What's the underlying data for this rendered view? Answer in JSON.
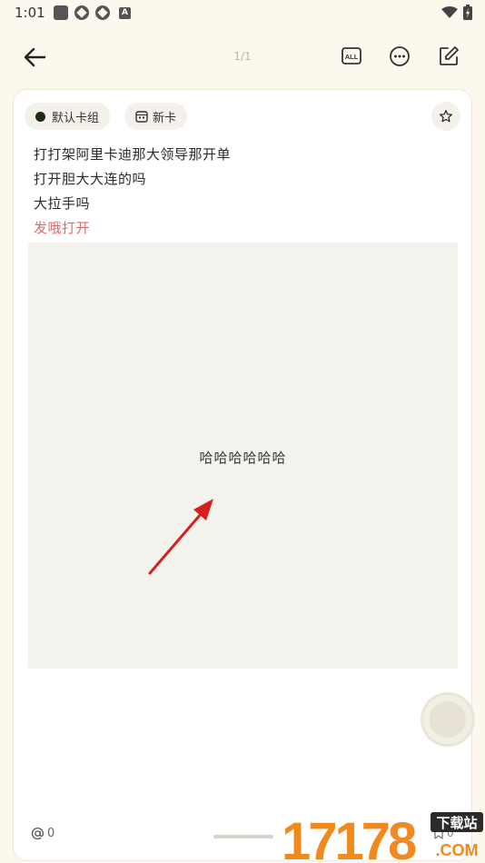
{
  "status_bar": {
    "time": "1:01",
    "left_icons": [
      "app-square-icon",
      "sync-icon",
      "sync-icon",
      "a-icon"
    ],
    "a_icon_text": "A",
    "right_icons": [
      "wifi-icon",
      "battery-icon"
    ]
  },
  "top_bar": {
    "page_indicator": "1/1",
    "all_label": "ALL",
    "icons": [
      "back-arrow-icon",
      "all-icon",
      "more-icon",
      "edit-icon"
    ]
  },
  "card": {
    "deck_chip": "默认卡组",
    "new_chip": "新卡",
    "lines": [
      "打打架阿里卡迪那大领导那开单",
      "打开胆大大连的吗",
      "大拉手吗"
    ],
    "red_line": "发哦打开",
    "media_text": "哈哈哈哈哈哈",
    "mention_count": "0",
    "bookmark_count": "0"
  },
  "watermark": {
    "text": "17178",
    "sub_top": "下载站",
    "sub_bottom": ".COM"
  },
  "colors": {
    "background": "#fcf8ed",
    "card": "#ffffff",
    "chip": "#f3f1ea",
    "red_text": "#e06a6a",
    "arrow": "#d62020",
    "watermark_orange": "#f08a1e"
  }
}
